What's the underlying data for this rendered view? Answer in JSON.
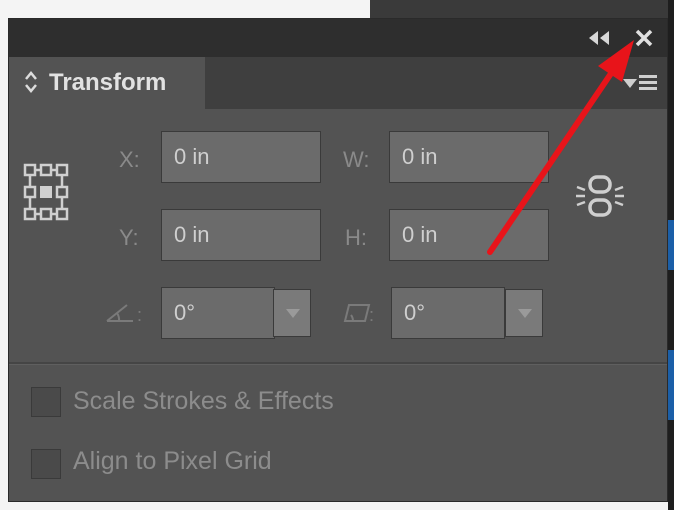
{
  "titlebar": {
    "collapse_icon": "double-chevron-left-icon",
    "close_icon": "close-icon"
  },
  "tab": {
    "label": "Transform",
    "arrows_icon": "updown-arrows-icon",
    "menu_icon": "panel-menu-icon"
  },
  "fields": {
    "x": {
      "label": "X:",
      "value": "0 in"
    },
    "y": {
      "label": "Y:",
      "value": "0 in"
    },
    "w": {
      "label": "W:",
      "value": "0 in"
    },
    "h": {
      "label": "H:",
      "value": "0 in"
    },
    "rotate": {
      "value": "0°",
      "icon": "rotate-angle-icon"
    },
    "shear": {
      "value": "0°",
      "icon": "shear-icon"
    }
  },
  "link_icon": "constrain-proportions-link-icon",
  "reference_point_icon": "reference-point-grid-icon",
  "options": {
    "scale_strokes": {
      "label": "Scale Strokes & Effects",
      "checked": false
    },
    "align_pixel": {
      "label": "Align to Pixel Grid",
      "checked": false
    }
  },
  "annotation": {
    "color": "#e8141a",
    "icon": "red-arrow-annotation"
  }
}
